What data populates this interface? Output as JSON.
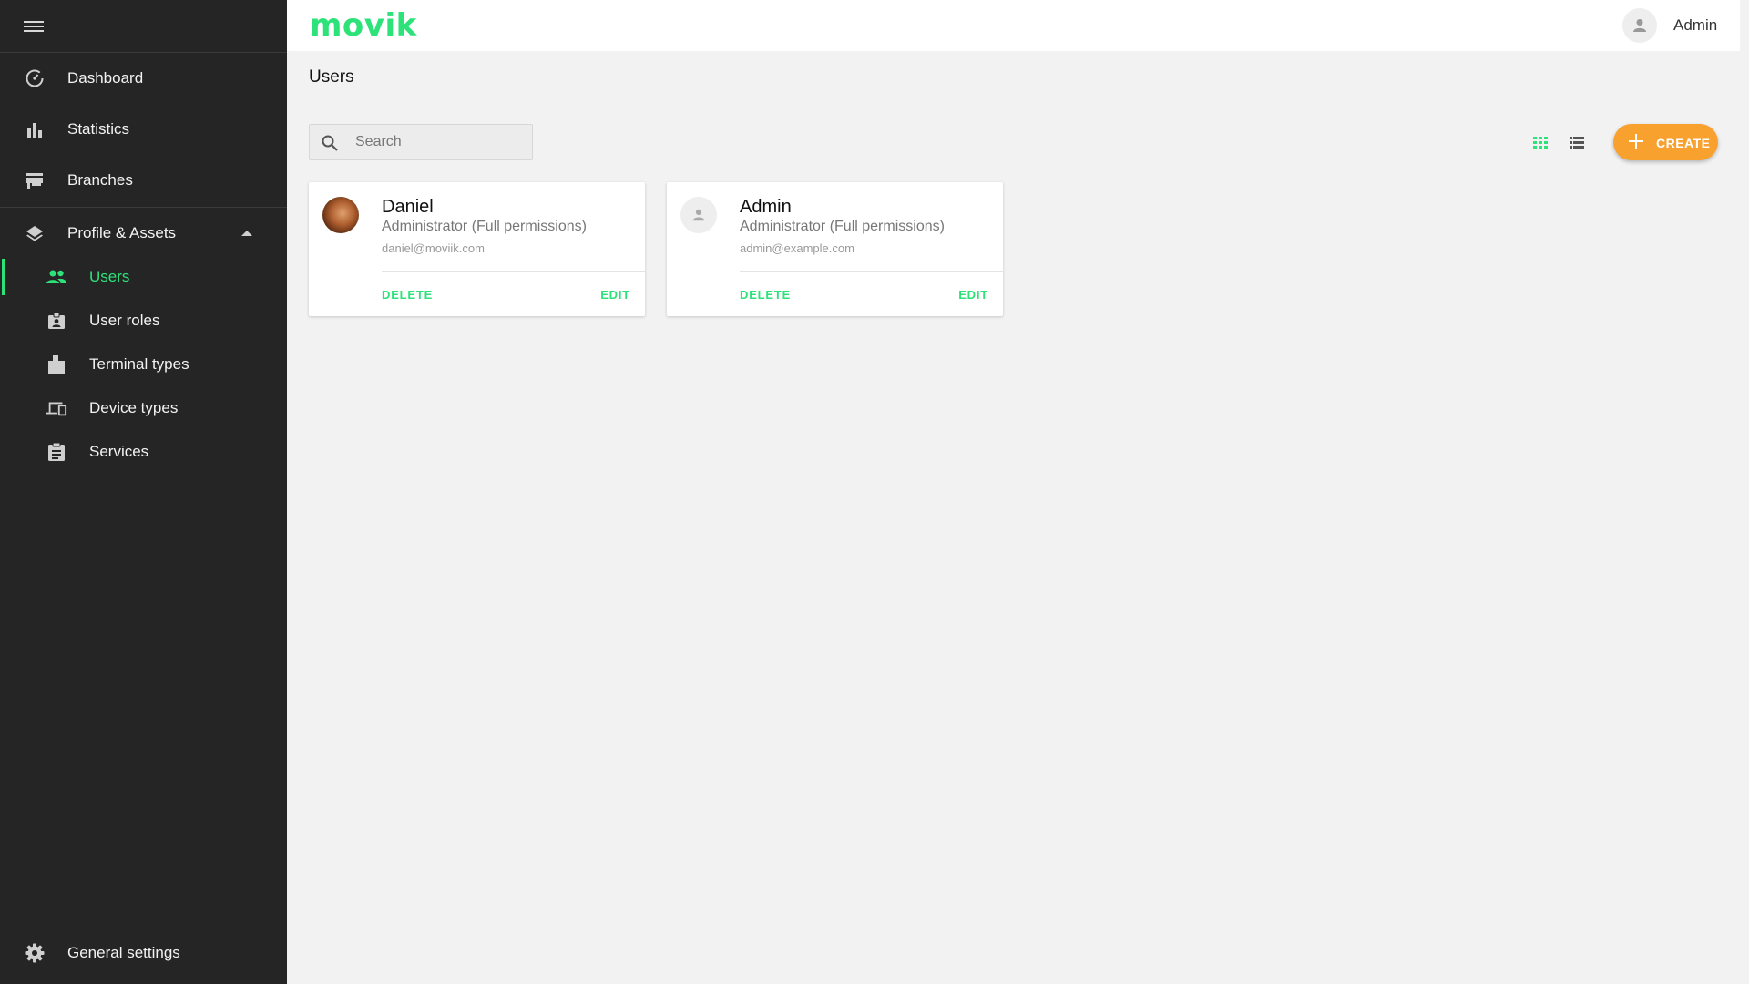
{
  "app": {
    "logo": "movik",
    "accent_color": "#2ee27a",
    "create_color": "#f9a12f"
  },
  "header": {
    "user_name": "Admin"
  },
  "sidebar": {
    "items": [
      {
        "label": "Dashboard",
        "icon": "dashboard-icon"
      },
      {
        "label": "Statistics",
        "icon": "bar-chart-icon"
      },
      {
        "label": "Branches",
        "icon": "store-icon"
      }
    ],
    "group": {
      "label": "Profile & Assets",
      "icon": "layers-icon",
      "expanded": true
    },
    "sub_items": [
      {
        "label": "Users",
        "icon": "people-icon",
        "active": true
      },
      {
        "label": "User roles",
        "icon": "badge-icon"
      },
      {
        "label": "Terminal types",
        "icon": "terminal-icon"
      },
      {
        "label": "Device types",
        "icon": "devices-icon"
      },
      {
        "label": "Services",
        "icon": "clipboard-icon"
      }
    ],
    "footer": {
      "label": "General settings",
      "icon": "gear-icon"
    }
  },
  "main": {
    "title": "Users",
    "search_placeholder": "Search",
    "create_label": "CREATE",
    "users": [
      {
        "name": "Daniel",
        "role": "Administrator (Full permissions)",
        "email": "daniel@moviik.com",
        "avatar": "photo",
        "delete_label": "DELETE",
        "edit_label": "EDIT"
      },
      {
        "name": "Admin",
        "role": "Administrator (Full permissions)",
        "email": "admin@example.com",
        "avatar": "placeholder",
        "delete_label": "DELETE",
        "edit_label": "EDIT"
      }
    ]
  }
}
